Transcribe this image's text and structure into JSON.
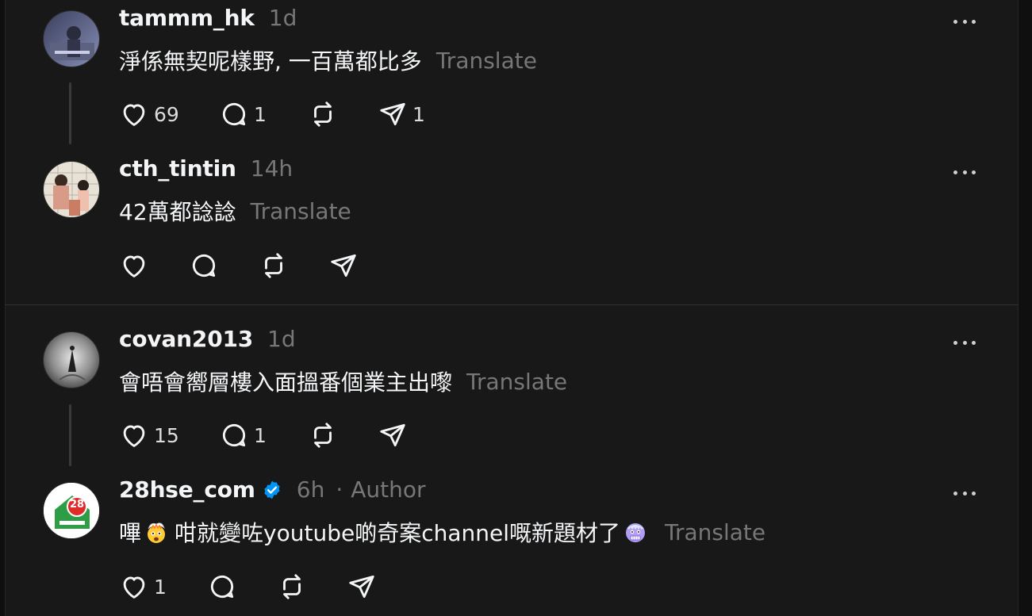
{
  "posts": [
    {
      "username": "tammm_hk",
      "time": "1d",
      "text": "淨係無契呢樣野, 一百萬都比多",
      "translate": "Translate",
      "likes": "69",
      "replies": "1",
      "shares": "1"
    },
    {
      "username": "cth_tintin",
      "time": "14h",
      "text": "42萬都諗諗",
      "translate": "Translate"
    },
    {
      "username": "covan2013",
      "time": "1d",
      "text": "會唔會嚮層樓入面搵番個業主出嚟",
      "translate": "Translate",
      "likes": "15",
      "replies": "1"
    },
    {
      "username": "28hse_com",
      "time": "6h",
      "author_dot": "·",
      "author_label": "Author",
      "text_part1": "嗶",
      "text_part2": "咁就變咗youtube啲奇案channel嘅新題材了",
      "translate": "Translate",
      "likes": "1",
      "avatar_text": "28"
    }
  ],
  "icons": [
    "heart-icon",
    "comment-icon",
    "repost-icon",
    "share-icon",
    "more-icon",
    "verified-icon"
  ],
  "colors": {
    "verified": "#0095f6",
    "muted": "#777777",
    "background": "#181818"
  }
}
